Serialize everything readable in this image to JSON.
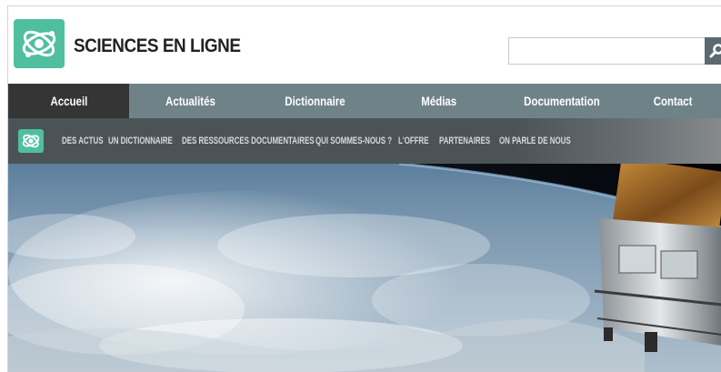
{
  "site": {
    "title": "SCIENCES EN LIGNE",
    "logo_icon": "atom-logo-icon",
    "brand_color": "#4fbf9f"
  },
  "search": {
    "value": "",
    "placeholder": "",
    "button_icon": "search-icon"
  },
  "main_nav": {
    "items": [
      {
        "label": "Accueil",
        "active": true
      },
      {
        "label": "Actualités",
        "active": false
      },
      {
        "label": "Dictionnaire",
        "active": false
      },
      {
        "label": "Médias",
        "active": false
      },
      {
        "label": "Documentation",
        "active": false
      },
      {
        "label": "Contact",
        "active": false
      }
    ],
    "color": "#6f8288",
    "active_color": "#353535"
  },
  "sub_nav": {
    "items": [
      {
        "label": "DES ACTUS"
      },
      {
        "label": "UN DICTIONNAIRE"
      },
      {
        "label": "DES RESSOURCES DOCUMENTAIRES"
      },
      {
        "label": "QUI SOMMES-NOUS ?"
      },
      {
        "label": "L'OFFRE"
      },
      {
        "label": "PARTENAIRES"
      },
      {
        "label": "ON PARLE DE NOUS"
      }
    ]
  },
  "hero": {
    "image": "earth-from-space-with-satellite"
  }
}
